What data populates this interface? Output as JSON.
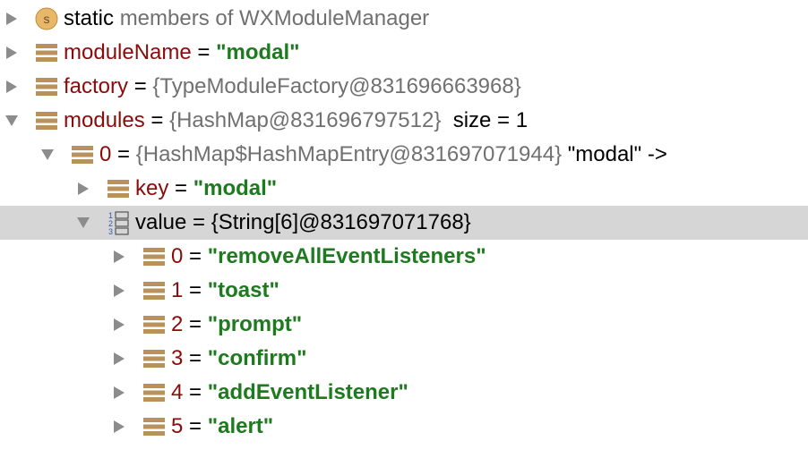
{
  "rows": [
    {
      "depth": 0,
      "expanded": false,
      "icon": "static-class-icon",
      "name": "static",
      "rest": "members of WXModuleManager"
    },
    {
      "depth": 0,
      "expanded": false,
      "icon": "field-icon",
      "name": "moduleName",
      "eq": "=",
      "value": "\"modal\""
    },
    {
      "depth": 0,
      "expanded": false,
      "icon": "field-icon",
      "name": "factory",
      "eq": "=",
      "ref": "{TypeModuleFactory@831696663968}"
    },
    {
      "depth": 0,
      "expanded": true,
      "icon": "field-icon",
      "name": "modules",
      "eq": "=",
      "ref": "{HashMap@831696797512}",
      "extra": "size = 1"
    },
    {
      "depth": 1,
      "expanded": true,
      "icon": "field-icon",
      "name": "0",
      "eq": "=",
      "ref": "{HashMap$HashMapEntry@831697071944}",
      "extra": "\"modal\" ->"
    },
    {
      "depth": 2,
      "expanded": false,
      "icon": "field-icon",
      "name": "key",
      "eq": "=",
      "value": "\"modal\""
    },
    {
      "depth": 2,
      "expanded": true,
      "selected": true,
      "icon": "array-icon",
      "name": "value",
      "eq": "=",
      "ref": "{String[6]@831697071768}"
    },
    {
      "depth": 3,
      "expanded": false,
      "icon": "field-icon",
      "name": "0",
      "eq": "=",
      "value": "\"removeAllEventListeners\""
    },
    {
      "depth": 3,
      "expanded": false,
      "icon": "field-icon",
      "name": "1",
      "eq": "=",
      "value": "\"toast\""
    },
    {
      "depth": 3,
      "expanded": false,
      "icon": "field-icon",
      "name": "2",
      "eq": "=",
      "value": "\"prompt\""
    },
    {
      "depth": 3,
      "expanded": false,
      "icon": "field-icon",
      "name": "3",
      "eq": "=",
      "value": "\"confirm\""
    },
    {
      "depth": 3,
      "expanded": false,
      "icon": "field-icon",
      "name": "4",
      "eq": "=",
      "value": "\"addEventListener\""
    },
    {
      "depth": 3,
      "expanded": false,
      "icon": "field-icon",
      "name": "5",
      "eq": "=",
      "value": "\"alert\""
    }
  ],
  "colors": {
    "member_name": "#8b0a0a",
    "string_value": "#1e7a1e",
    "reference": "#707070",
    "selection": "#d6d6d6",
    "field_icon": "#b8925a",
    "static_icon": "#e8b86a"
  }
}
